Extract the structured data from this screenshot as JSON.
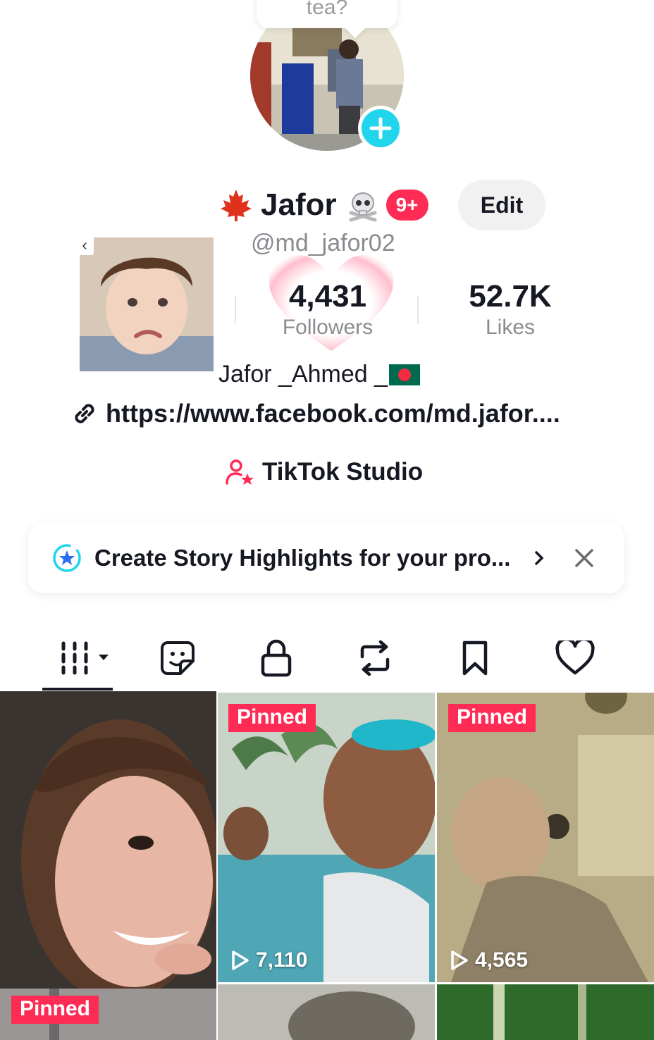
{
  "bubble_text": "tea?",
  "profile": {
    "name": "Jafor",
    "notification_badge": "9+",
    "edit_label": "Edit",
    "handle": "@md_jafor02",
    "followers_count": "4,431",
    "followers_label": "Followers",
    "likes_count": "52.7K",
    "likes_label": "Likes",
    "display_name": "Jafor _Ahmed _",
    "link": "https://www.facebook.com/md.jafor....",
    "studio_label": "TikTok Studio"
  },
  "highlight_banner": {
    "text": "Create Story Highlights for your pro..."
  },
  "tabs": [
    {
      "icon": "grid-icon",
      "active": true
    },
    {
      "icon": "sticker-icon"
    },
    {
      "icon": "lock-icon"
    },
    {
      "icon": "repost-icon"
    },
    {
      "icon": "bookmark-icon"
    },
    {
      "icon": "heart-icon"
    }
  ],
  "videos": [
    {
      "pinned_label": "Pinned",
      "views": ""
    },
    {
      "pinned_label": "Pinned",
      "views": "7,110"
    },
    {
      "pinned_label": "Pinned",
      "views": "4,565"
    }
  ],
  "colors": {
    "accent": "#fe2c55",
    "cyan": "#20d5ec",
    "text": "#161823",
    "muted": "#8a8b91"
  }
}
